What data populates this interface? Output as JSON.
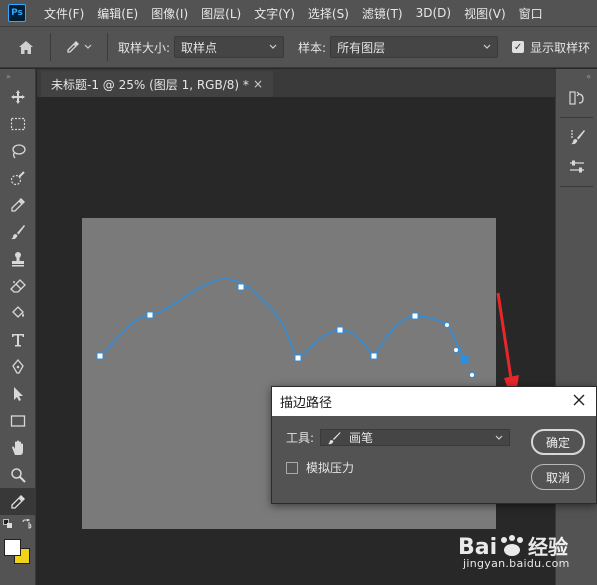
{
  "app": {
    "logo": "Ps"
  },
  "menu": [
    "文件(F)",
    "编辑(E)",
    "图像(I)",
    "图层(L)",
    "文字(Y)",
    "选择(S)",
    "滤镜(T)",
    "3D(D)",
    "视图(V)",
    "窗口"
  ],
  "options": {
    "sample_size_label": "取样大小:",
    "sample_size_value": "取样点",
    "sample_label": "样本:",
    "sample_value": "所有图层",
    "show_ring_label": "显示取样环"
  },
  "document": {
    "tab_title": "未标题-1 @ 25% (图层 1, RGB/8) *",
    "close": "×"
  },
  "dialog": {
    "title": "描边路径",
    "tool_label": "工具:",
    "tool_value": "画笔",
    "simulate_pressure_label": "模拟压力",
    "simulate_pressure_checked": false,
    "ok_label": "确定",
    "cancel_label": "取消"
  },
  "watermark": {
    "brand": "Bai",
    "brand2": "经验",
    "url": "jingyan.baidu.com"
  },
  "colors": {
    "path_stroke": "#2e8fe0",
    "arrow": "#e8272a",
    "foreground": "#ffffff",
    "background": "#f0d21a"
  },
  "icons": {
    "toolbar": [
      "move-icon",
      "marquee-icon",
      "lasso-icon",
      "quick-select-icon",
      "eyedropper-icon",
      "brush-icon",
      "stamp-icon",
      "eraser-icon",
      "paint-bucket-icon",
      "type-icon",
      "pen-icon",
      "path-select-icon",
      "rectangle-icon",
      "hand-icon",
      "zoom-icon",
      "color-sampler-icon"
    ]
  }
}
